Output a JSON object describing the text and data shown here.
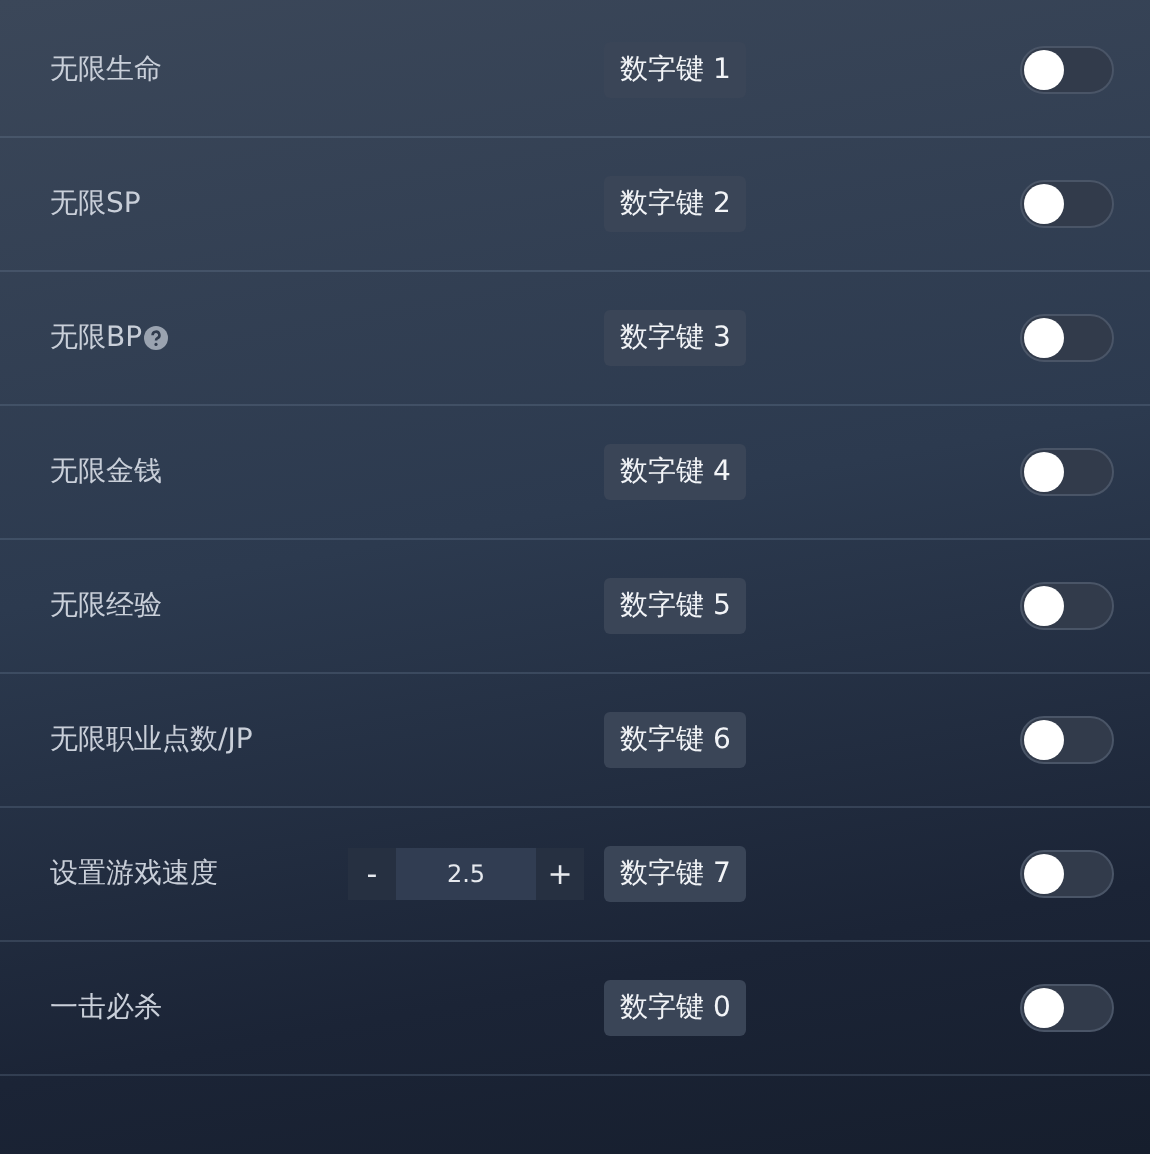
{
  "rows": [
    {
      "label": "无限生命",
      "help": false,
      "key": "数字键 1",
      "on": false
    },
    {
      "label": "无限SP",
      "help": false,
      "key": "数字键 2",
      "on": false
    },
    {
      "label": "无限BP",
      "help": true,
      "key": "数字键 3",
      "on": false
    },
    {
      "label": "无限金钱",
      "help": false,
      "key": "数字键 4",
      "on": false
    },
    {
      "label": "无限经验",
      "help": false,
      "key": "数字键 5",
      "on": false
    },
    {
      "label": "无限职业点数/JP",
      "help": false,
      "key": "数字键 6",
      "on": false
    },
    {
      "label": "设置游戏速度",
      "help": false,
      "stepper": {
        "minus": "-",
        "value": "2.5",
        "plus": "+"
      },
      "key": "数字键 7",
      "on": false
    },
    {
      "label": "一击必杀",
      "help": false,
      "key": "数字键 0",
      "on": false
    }
  ]
}
